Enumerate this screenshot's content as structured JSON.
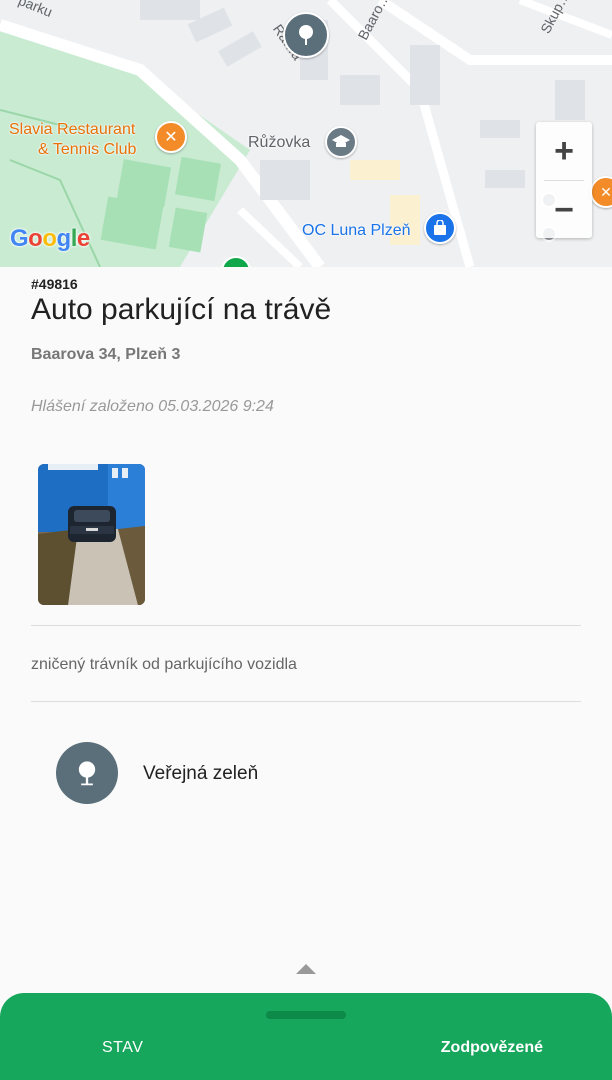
{
  "map": {
    "street_labels": [
      "parku",
      "Ra…a",
      "Baaro…",
      "Skup…"
    ],
    "poi": {
      "restaurant_line1": "Slavia Restaurant",
      "restaurant_line2": "& Tennis Club",
      "school": "Růžovka",
      "mall": "OC Luna Plzeň"
    },
    "google_logo": "Google",
    "zoom_in_label": "+",
    "zoom_out_label": "−"
  },
  "report": {
    "id": "#49816",
    "title": "Auto parkující na trávě",
    "address": "Baarova 34, Plzeň 3",
    "created": "Hlášení založeno 05.03.2026 9:24",
    "description": "zničený trávník od parkujícího vozidla",
    "category": "Veřejná zeleň"
  },
  "bottom_sheet": {
    "status_label": "STAV",
    "status_value": "Zodpovězené"
  },
  "colors": {
    "accent_green": "#16a75c",
    "category_icon_bg": "#5b6f7b",
    "poi_orange": "#e8710a",
    "poi_blue": "#1a73e8"
  }
}
